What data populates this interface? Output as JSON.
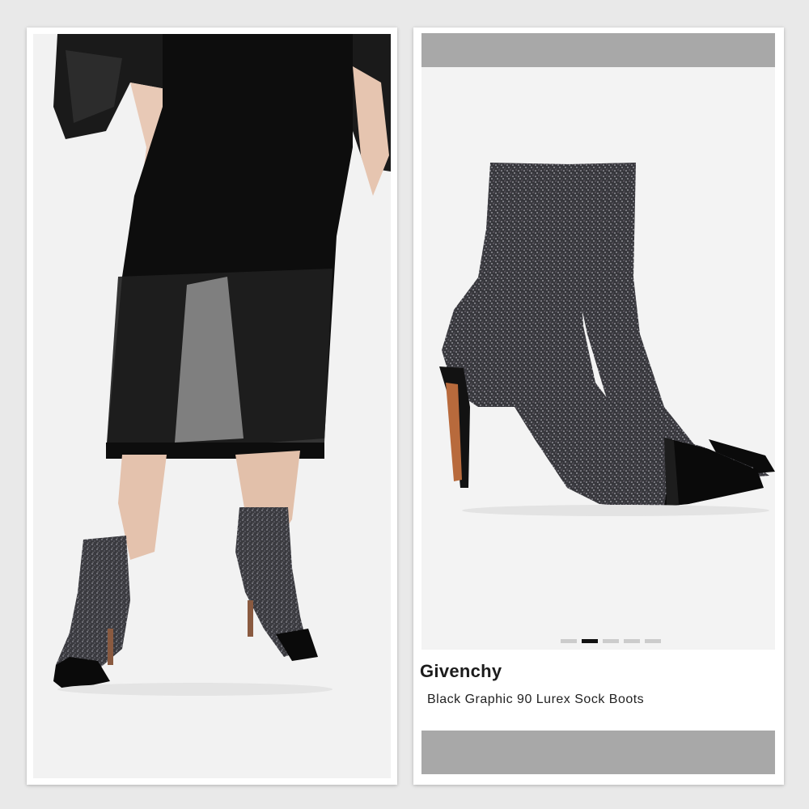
{
  "product": {
    "brand": "Givenchy",
    "name": "Black Graphic 90 Lurex Sock Boots"
  },
  "gallery": {
    "image_count": 5,
    "active_index": 1
  },
  "colors": {
    "background": "#e9e9e9",
    "panel": "#ffffff",
    "bar": "#a8a8a8",
    "dot_active": "#111111",
    "dot_inactive": "#cccccc"
  }
}
